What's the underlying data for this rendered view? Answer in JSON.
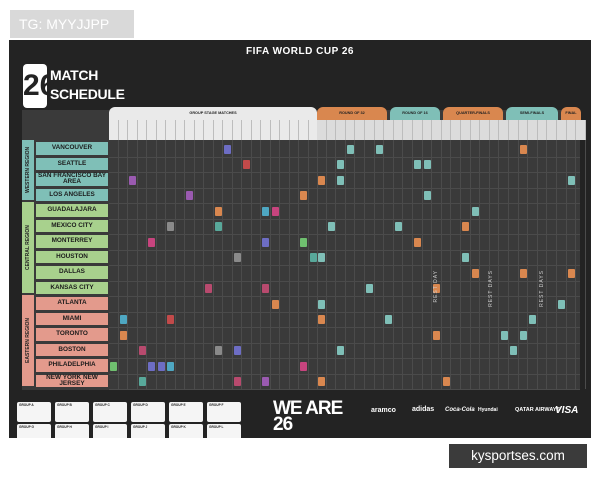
{
  "overlay": {
    "tag": "TG: MYYJJPP",
    "watermark": "kysportses.com"
  },
  "poster": {
    "header": "FIFA WORLD CUP 26",
    "logo": {
      "number": "26",
      "title_line1": "MATCH",
      "title_line2": "SCHEDULE"
    },
    "stage_headers": [
      {
        "label": "GROUP STAGE MATCHES",
        "color": "#eaeaea"
      },
      {
        "label": "ROUND OF 32",
        "color": "#d9874f"
      },
      {
        "label": "ROUND OF 16",
        "color": "#7fbfb7"
      },
      {
        "label": "QUARTER-FINALS",
        "color": "#d9874f"
      },
      {
        "label": "SEMI-FINALS",
        "color": "#7fbfb7"
      },
      {
        "label": "FINAL",
        "color": "#d9874f"
      }
    ],
    "regions": [
      {
        "name": "WESTERN REGION",
        "color": "#7fbfb7"
      },
      {
        "name": "CENTRAL REGION",
        "color": "#a8d18d"
      },
      {
        "name": "EASTERN REGION",
        "color": "#e39a8c"
      }
    ],
    "cities": [
      {
        "name": "VANCOUVER",
        "region": 0
      },
      {
        "name": "SEATTLE",
        "region": 0
      },
      {
        "name": "SAN FRANCISCO BAY AREA",
        "region": 0
      },
      {
        "name": "LOS ANGELES",
        "region": 0
      },
      {
        "name": "GUADALAJARA",
        "region": 1
      },
      {
        "name": "MEXICO CITY",
        "region": 1
      },
      {
        "name": "MONTERREY",
        "region": 1
      },
      {
        "name": "HOUSTON",
        "region": 1
      },
      {
        "name": "DALLAS",
        "region": 1
      },
      {
        "name": "KANSAS CITY",
        "region": 1
      },
      {
        "name": "ATLANTA",
        "region": 2
      },
      {
        "name": "MIAMI",
        "region": 2
      },
      {
        "name": "TORONTO",
        "region": 2
      },
      {
        "name": "BOSTON",
        "region": 2
      },
      {
        "name": "PHILADELPHIA",
        "region": 2
      },
      {
        "name": "NEW YORK NEW JERSEY",
        "region": 2
      }
    ],
    "rest_day_label": "REST DAYS",
    "rest_day_single": "REST DAY",
    "footer": {
      "brand": "WE ARE 26",
      "sponsors": [
        "aramco",
        "adidas",
        "Coca-Cola",
        "Hyundai",
        "QATAR AIRWAYS",
        "VISA"
      ]
    }
  },
  "colors": {
    "poster_bg": "#232323",
    "grid_bg": "#3a3a3a",
    "accent_orange": "#d9874f",
    "accent_teal": "#7fbfb7",
    "match_colors": [
      "#c7447e",
      "#4ea7c2",
      "#8a8a8a",
      "#b84a6e",
      "#6d6dc4",
      "#d9874f",
      "#6fbf6f",
      "#c24a4a",
      "#58a89a",
      "#9a5ab0"
    ]
  }
}
